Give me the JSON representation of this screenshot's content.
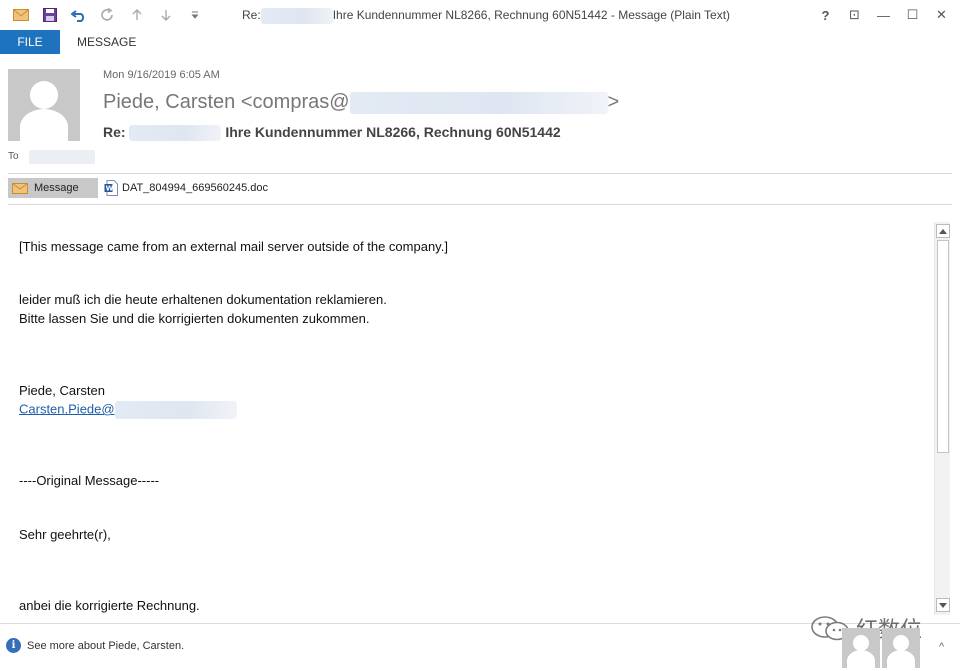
{
  "window": {
    "title_prefix": "Re:",
    "title_suffix": "Ihre Kundennummer NL8266, Rechnung 60N51442 - Message (Plain Text)",
    "help": "?",
    "ribbon_display": "⊡",
    "minimize": "—",
    "maximize": "☐",
    "close": "✕"
  },
  "tabs": {
    "file": "FILE",
    "message": "MESSAGE"
  },
  "header": {
    "date": "Mon 9/16/2019 6:05 AM",
    "sender_name": "Piede, Carsten <compras@",
    "sender_end": ">",
    "subject_prefix": "Re:",
    "subject_main": "Ihre Kundennummer NL8266, Rechnung 60N51442",
    "to_label": "To"
  },
  "attachments": {
    "message_tab": "Message",
    "file_name": "DAT_804994_669560245.doc"
  },
  "body": {
    "line1": "[This message came from an external mail server outside of the company.]",
    "line2": "leider muß ich die heute erhaltenen dokumentation reklamieren.",
    "line3": "Bitte lassen Sie und die korrigierten dokumenten zukommen.",
    "line4": "Piede, Carsten",
    "link": "Carsten.Piede@",
    "line5": "----Original Message-----",
    "line6": "Sehr geehrte(r),",
    "line7": "anbei die korrigierte Rechnung."
  },
  "people_pane": {
    "info": "See more about Piede, Carsten.",
    "expand": "^"
  },
  "watermark": {
    "text": "红数位"
  },
  "colors": {
    "accent": "#1e73be",
    "link": "#1f5fa8"
  }
}
